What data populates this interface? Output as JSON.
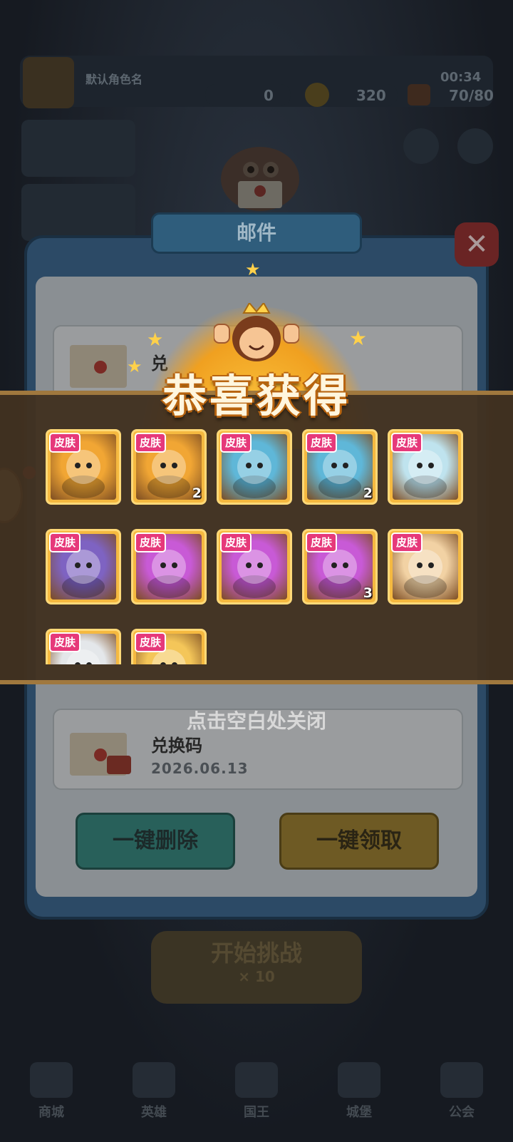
{
  "hud": {
    "player_name": "默认角色名",
    "currency_a": "0",
    "coins": "320",
    "timer": "00:34",
    "energy": "70/80"
  },
  "mail": {
    "title": "邮件",
    "items": [
      {
        "name": "兑",
        "date": ""
      },
      {
        "name": "兑换码",
        "date": "2026.06.13"
      }
    ],
    "delete_all_label": "一键删除",
    "claim_all_label": "一键领取"
  },
  "start": {
    "label": "开始挑战",
    "cost": "× 10"
  },
  "nav": [
    "商城",
    "英雄",
    "国王",
    "城堡",
    "公会"
  ],
  "reward": {
    "title": "恭喜获得",
    "hint": "点击空白处关闭",
    "tag_label": "皮肤",
    "cards": [
      {
        "icon": "green-goblin-skin-icon",
        "count": "",
        "bg": "#f1a634"
      },
      {
        "icon": "green-goblin-skin-icon",
        "count": "2",
        "bg": "#f1a634"
      },
      {
        "icon": "ghost-visor-skin-icon",
        "count": "",
        "bg": "#5fb7d8"
      },
      {
        "icon": "ghost-visor-skin-icon",
        "count": "2",
        "bg": "#5fb7d8"
      },
      {
        "icon": "polar-bear-hood-skin-icon",
        "count": "",
        "bg": "#bfe3ee"
      },
      {
        "icon": "pirate-hat-skin-icon",
        "count": "",
        "bg": "#7e63c2"
      },
      {
        "icon": "pink-hair-witch-skin-icon",
        "count": "",
        "bg": "#c85ad6"
      },
      {
        "icon": "pink-hair-witch-skin-icon",
        "count": "",
        "bg": "#c85ad6"
      },
      {
        "icon": "pink-hair-witch-skin-icon",
        "count": "3",
        "bg": "#c85ad6"
      },
      {
        "icon": "red-hair-gunner-skin-icon",
        "count": "",
        "bg": "#f2d2a4"
      },
      {
        "icon": "white-robot-skin-icon",
        "count": "",
        "bg": "#e4e7ea"
      },
      {
        "icon": "golden-staff-skin-icon",
        "count": "",
        "bg": "#f4c659"
      }
    ]
  },
  "colors": {
    "card_tag": "#e6397a",
    "card_frame": "#f5b940",
    "banner": "#42311f",
    "title_outline": "#b8640f"
  }
}
